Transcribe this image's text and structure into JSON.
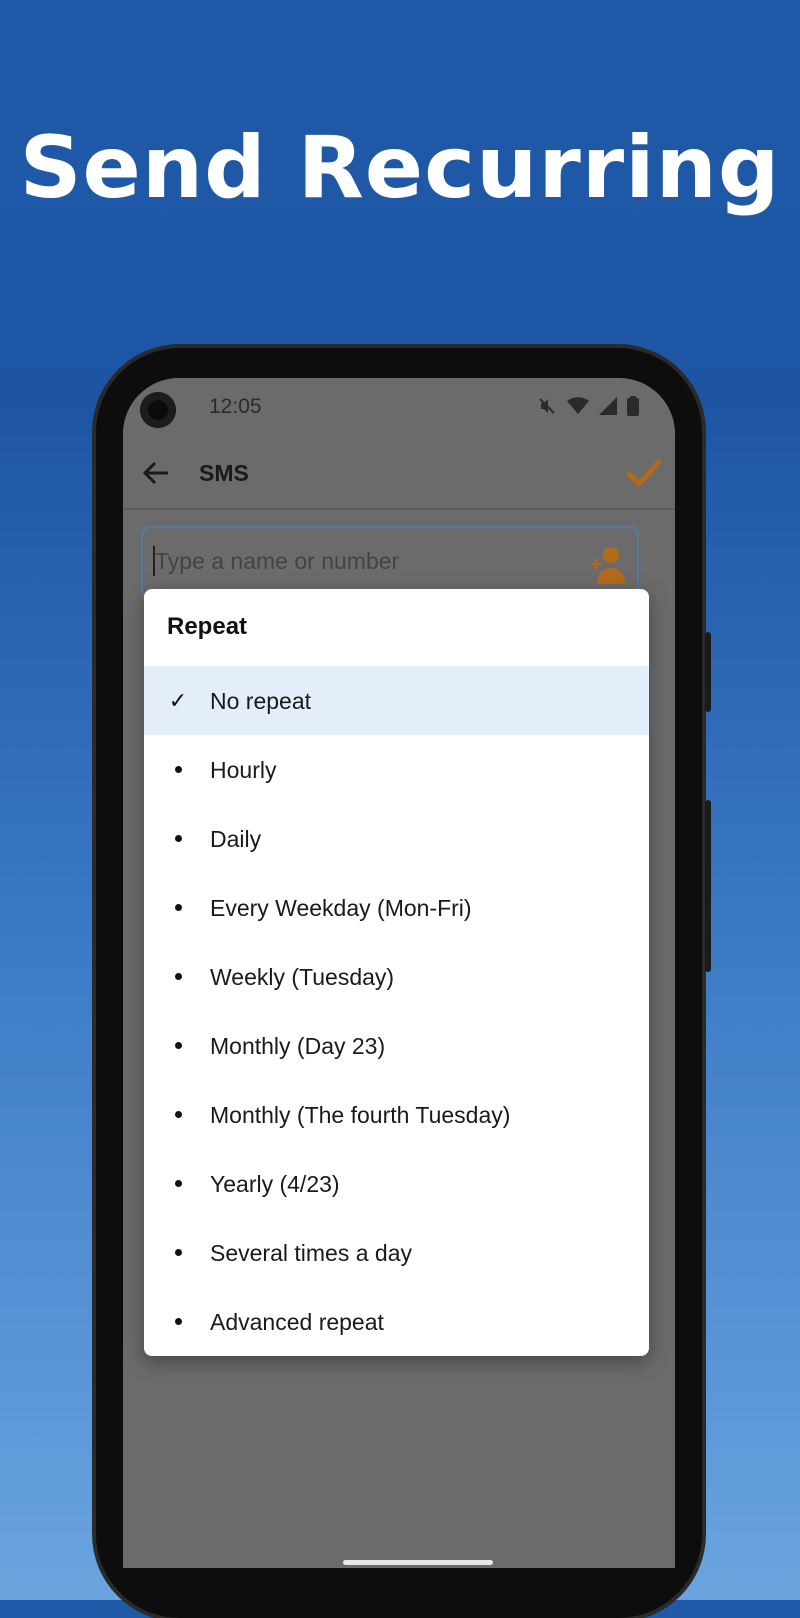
{
  "headline": "Send Recurring",
  "colors": {
    "accent": "#e6891c",
    "selected_bg": "#e3eefa",
    "background_top": "#1e5aa8",
    "background_bottom": "#6aa5e0"
  },
  "status_bar": {
    "time": "12:05",
    "icons": [
      "mute-icon",
      "wifi-icon",
      "signal-icon",
      "battery-icon"
    ]
  },
  "app_bar": {
    "title": "SMS",
    "back_icon": "arrow-left-icon",
    "confirm_icon": "checkmark-icon"
  },
  "recipient": {
    "placeholder": "Type a name or number",
    "icon": "add-contact-icon"
  },
  "dialog": {
    "title": "Repeat",
    "options": [
      {
        "label": "No repeat",
        "selected": true
      },
      {
        "label": "Hourly",
        "selected": false
      },
      {
        "label": "Daily",
        "selected": false
      },
      {
        "label": "Every Weekday (Mon-Fri)",
        "selected": false
      },
      {
        "label": "Weekly (Tuesday)",
        "selected": false
      },
      {
        "label": "Monthly (Day 23)",
        "selected": false
      },
      {
        "label": "Monthly (The fourth Tuesday)",
        "selected": false
      },
      {
        "label": "Yearly (4/23)",
        "selected": false
      },
      {
        "label": "Several times a day",
        "selected": false
      },
      {
        "label": "Advanced repeat",
        "selected": false
      }
    ]
  }
}
